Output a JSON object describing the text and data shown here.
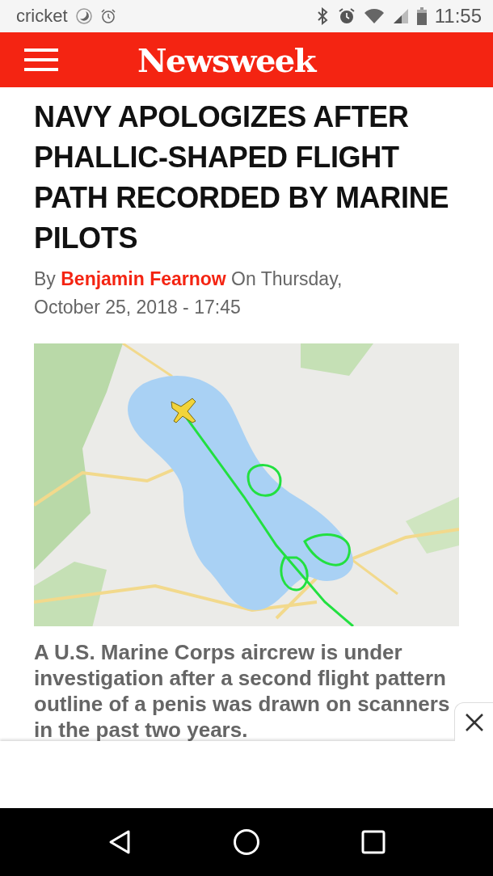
{
  "status_bar": {
    "carrier": "cricket",
    "time": "11:55"
  },
  "header": {
    "logo": "Newsweek"
  },
  "article": {
    "headline": "NAVY APOLOGIZES AFTER PHALLIC-SHAPED FLIGHT PATH RECORDED BY MARINE PILOTS",
    "byline_prefix": "By",
    "author": "Benjamin Fearnow",
    "dateline": "On Thursday, October 25, 2018 - 17:45",
    "summary": "A U.S. Marine Corps aircrew is under investigation after a second flight pattern outline of a penis was drawn on scanners in the past two years."
  }
}
